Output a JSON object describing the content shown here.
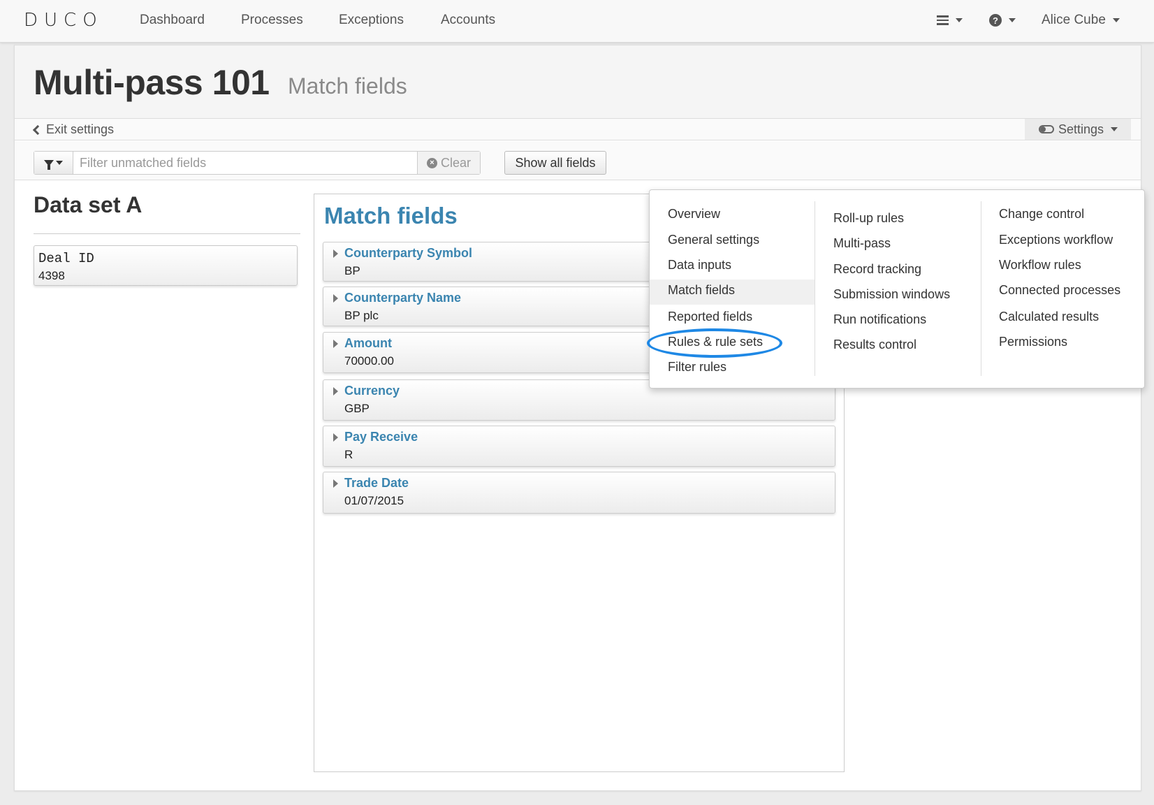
{
  "nav": {
    "logo": "DUCO",
    "links": [
      "Dashboard",
      "Processes",
      "Exceptions",
      "Accounts"
    ],
    "user": "Alice Cube",
    "menu_icon": "hamburger-icon",
    "help_icon": "question-icon"
  },
  "page": {
    "title": "Multi-pass 101",
    "subtitle": "Match fields"
  },
  "settings_bar": {
    "exit_label": "Exit settings",
    "settings_label": "Settings"
  },
  "toolbar": {
    "filter_placeholder": "Filter unmatched fields",
    "clear_label": "Clear",
    "show_all_label": "Show all fields"
  },
  "dataset_a": {
    "title": "Data set A",
    "fields": [
      {
        "name": "Deal ID",
        "value": "4398"
      }
    ]
  },
  "match_fields": {
    "title": "Match fields",
    "fields": [
      {
        "name": "Counterparty Symbol",
        "value": "BP"
      },
      {
        "name": "Counterparty Name",
        "value": "BP plc"
      },
      {
        "name": "Amount",
        "value": "70000.00"
      },
      {
        "name": "Currency",
        "value": "GBP"
      },
      {
        "name": "Pay Receive",
        "value": "R"
      },
      {
        "name": "Trade Date",
        "value": "01/07/2015"
      }
    ]
  },
  "settings_menu": {
    "col1": [
      "Overview",
      "General settings",
      "Data inputs",
      "Match fields",
      "Reported fields",
      "Rules & rule sets",
      "Filter rules"
    ],
    "col2": [
      "Roll-up rules",
      "Multi-pass",
      "Record tracking",
      "Submission windows",
      "Run notifications",
      "Results control"
    ],
    "col3": [
      "Change control",
      "Exceptions workflow",
      "Workflow rules",
      "Connected processes",
      "Calculated results",
      "Permissions"
    ],
    "active": "Match fields",
    "highlighted": "Rules & rule sets"
  },
  "colors": {
    "accent": "#3b85b0",
    "highlight_ring": "#1e88e5"
  }
}
